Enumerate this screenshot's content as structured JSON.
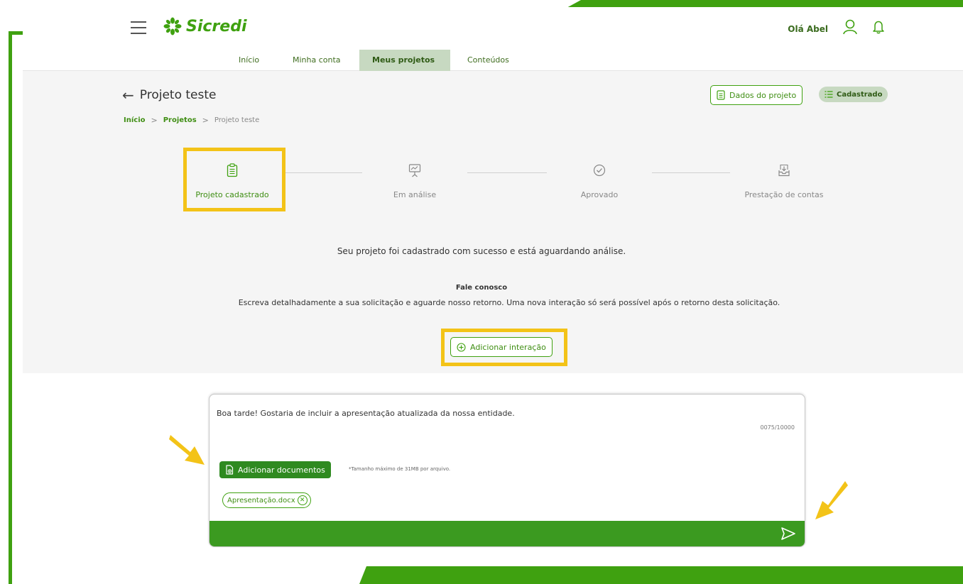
{
  "header": {
    "brand": "Sicredi",
    "greeting": "Olá Abel"
  },
  "nav": {
    "tabs": [
      {
        "label": "Início"
      },
      {
        "label": "Minha conta"
      },
      {
        "label": "Meus projetos"
      },
      {
        "label": "Conteúdos"
      }
    ],
    "active_tab": "Meus projetos"
  },
  "project": {
    "title": "Projeto teste",
    "data_button": "Dados do projeto",
    "status_badge": "Cadastrado"
  },
  "breadcrumb": {
    "items": [
      "Início",
      "Projetos",
      "Projeto teste"
    ]
  },
  "steps": [
    {
      "label": "Projeto cadastrado",
      "icon": "clipboard-icon"
    },
    {
      "label": "Em análise",
      "icon": "presentation-icon"
    },
    {
      "label": "Aprovado",
      "icon": "check-circle-icon"
    },
    {
      "label": "Prestação de contas",
      "icon": "inbox-download-icon"
    }
  ],
  "status_message": "Seu projeto foi cadastrado com sucesso e está aguardando análise.",
  "contact": {
    "title": "Fale conosco",
    "description": "Escreva detalhadamente a sua solicitação e aguarde nosso retorno. Uma nova interação só será possível após o retorno desta solicitação.",
    "add_button": "Adicionar interação"
  },
  "composer": {
    "message": "Boa tarde! Gostaria de incluir a apresentação atualizada da nossa entidade.",
    "char_count": "0075/10000",
    "add_docs_button": "Adicionar documentos",
    "docs_note": "*Tamanho máximo de 31MB por arquivo.",
    "attached_file": "Apresentação.docx"
  },
  "colors": {
    "brand_green": "#3fa110",
    "dark_green": "#2f8a20",
    "highlight_yellow": "#f3c318",
    "active_tab_bg": "#c7d9c1"
  }
}
